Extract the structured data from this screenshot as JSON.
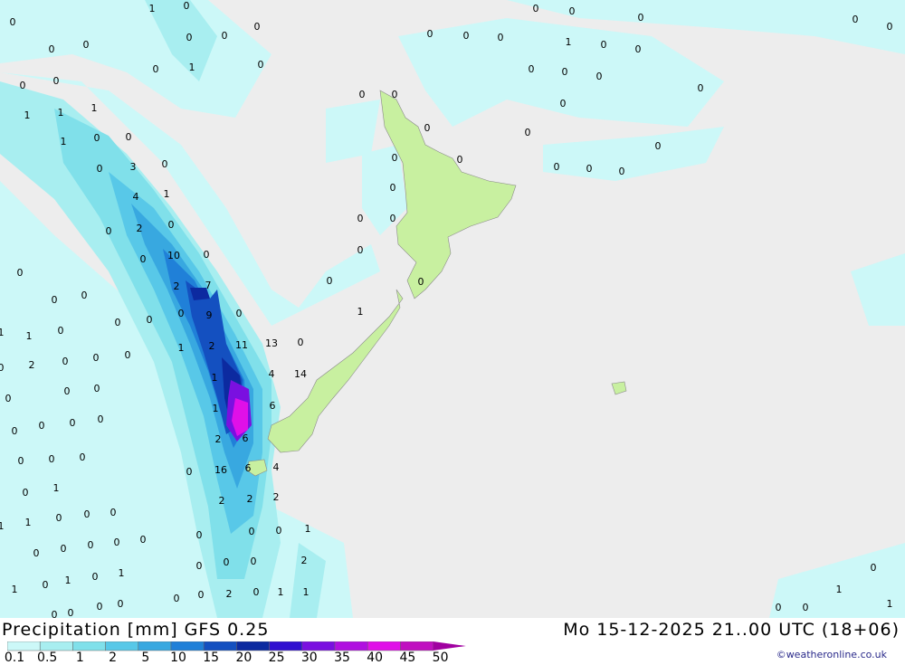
{
  "title": "Precipitation [mm]  GFS 0.25",
  "datetime": "Mo 15-12-2025 21..00 UTC (18+06)",
  "credit": "©weatheronline.co.uk",
  "colors": {
    "background": "#ededed",
    "land": "#c8f0a0",
    "scale": [
      "#ccf8f8",
      "#a8eef0",
      "#80e0ea",
      "#58c8e8",
      "#38a8e0",
      "#2080d8",
      "#1450c0",
      "#0c2aa0",
      "#3010d0",
      "#7a10e0",
      "#b010e0",
      "#e010e8",
      "#c010c0",
      "#a000a0"
    ]
  },
  "legend": {
    "ticks": [
      "0.1",
      "0.5",
      "1",
      "2",
      "5",
      "10",
      "15",
      "20",
      "25",
      "30",
      "35",
      "40",
      "45",
      "50"
    ]
  },
  "map_values": [
    "1",
    "0",
    "0",
    "0",
    "0",
    "0",
    "0",
    "0",
    "0",
    "0",
    "0",
    "0",
    "0",
    "0",
    "0",
    "0",
    "0",
    "0",
    "0",
    "0",
    "1",
    "0",
    "0",
    "0",
    "0",
    "0",
    "0",
    "0",
    "0",
    "0",
    "0",
    "0",
    "0",
    "0",
    "0",
    "0",
    "0",
    "0",
    "0",
    "0",
    "0",
    "0",
    "0",
    "0",
    "1",
    "1",
    "1",
    "1",
    "1",
    "1",
    "0",
    "0",
    "3",
    "1",
    "4",
    "2",
    "0",
    "10",
    "0",
    "2",
    "7",
    "9",
    "0",
    "1",
    "2",
    "11",
    "13",
    "0",
    "1",
    "4",
    "14",
    "1",
    "6",
    "2",
    "6",
    "16",
    "6",
    "4",
    "2",
    "2",
    "2",
    "0",
    "0",
    "1",
    "0",
    "0",
    "2",
    "2",
    "0",
    "1",
    "1",
    "0",
    "2",
    "1",
    "0",
    "1",
    "0",
    "0",
    "1",
    "1",
    "1",
    "1",
    "0",
    "0",
    "0",
    "0",
    "0",
    "0",
    "0",
    "0",
    "0",
    "0",
    "0",
    "0",
    "0",
    "0",
    "0",
    "0",
    "0",
    "0",
    "0",
    "0",
    "0",
    "0",
    "0",
    "0",
    "0",
    "0",
    "1",
    "1",
    "0",
    "0",
    "0",
    "0",
    "0",
    "0",
    "0",
    "1",
    "0",
    "1",
    "0",
    "0",
    "0",
    "0",
    "0",
    "0",
    "0",
    "0",
    "0",
    "0"
  ]
}
